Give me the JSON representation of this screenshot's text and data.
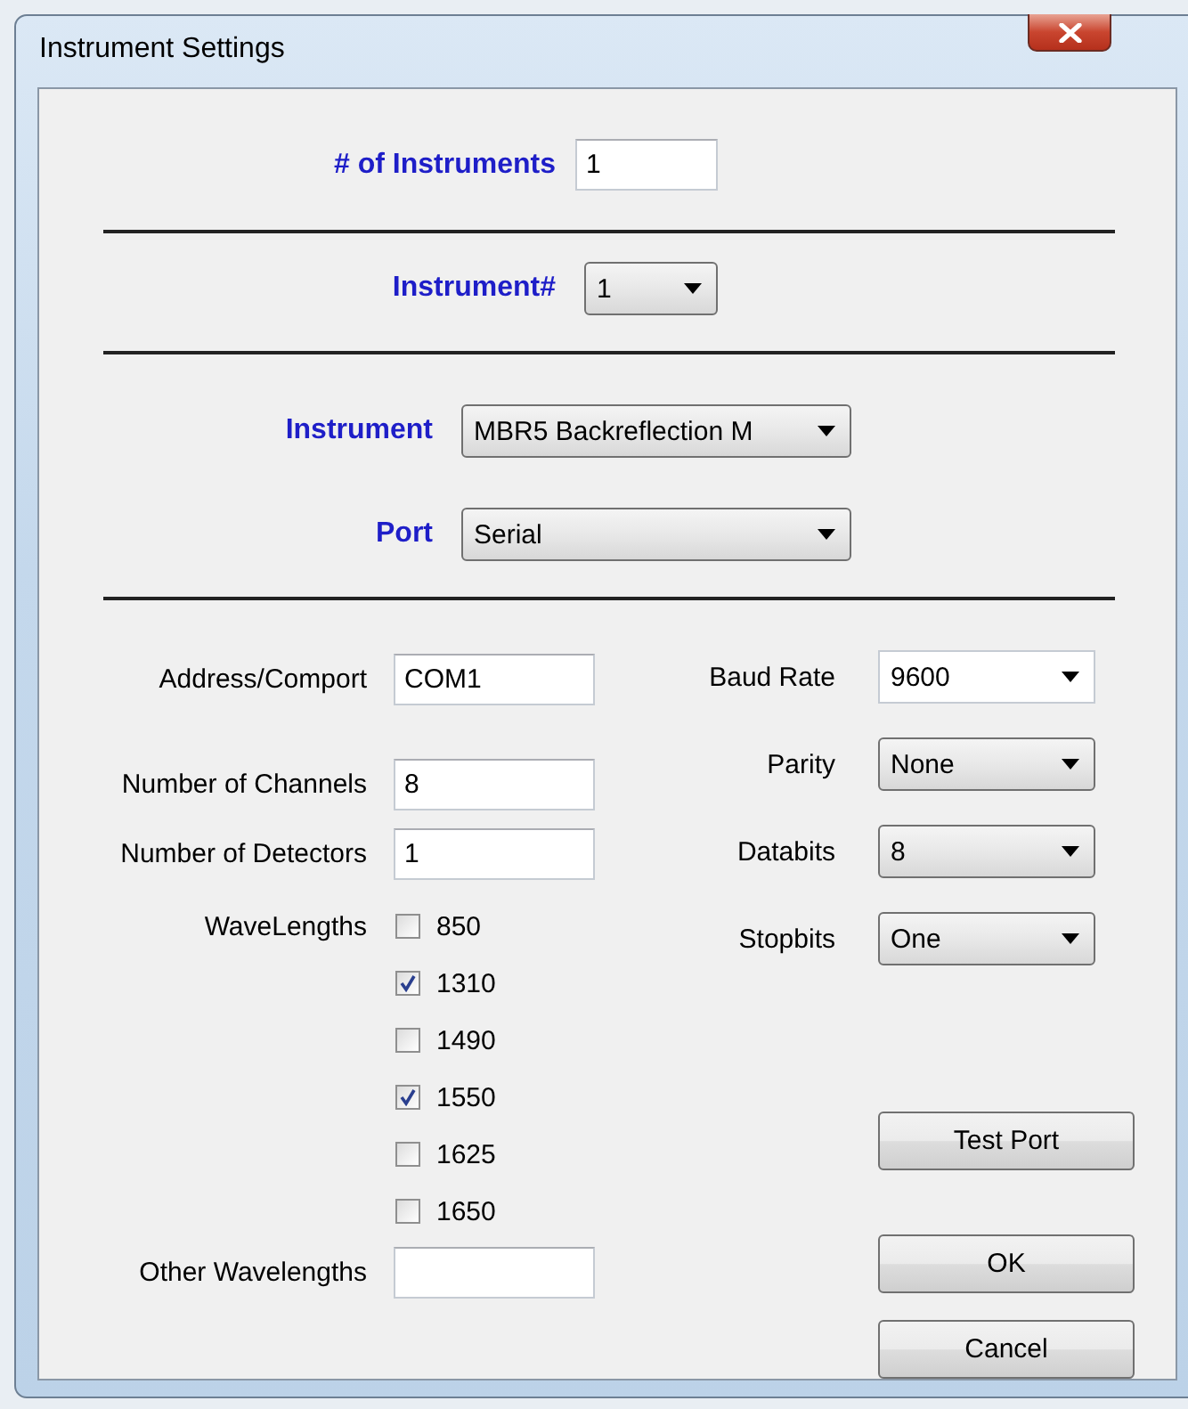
{
  "window": {
    "title": "Instrument Settings"
  },
  "instrument_count": {
    "label": "# of Instruments",
    "value": "1"
  },
  "instrument_number": {
    "label": "Instrument#",
    "value": "1"
  },
  "instrument": {
    "label": "Instrument",
    "value": "MBR5 Backreflection M"
  },
  "port": {
    "label": "Port",
    "value": "Serial"
  },
  "fields": [
    {
      "label": "Address/Comport",
      "value": "COM1"
    },
    {
      "label": "Number of Channels",
      "value": "8"
    },
    {
      "label": "Number of Detectors",
      "value": "1"
    }
  ],
  "wavelengths": {
    "label": "WaveLengths",
    "options": [
      {
        "label": "850",
        "checked": false
      },
      {
        "label": "1310",
        "checked": true
      },
      {
        "label": "1490",
        "checked": false
      },
      {
        "label": "1550",
        "checked": true
      },
      {
        "label": "1625",
        "checked": false
      },
      {
        "label": "1650",
        "checked": false
      }
    ]
  },
  "other_wavelengths": {
    "label": "Other Wavelengths"
  },
  "serial_settings": [
    {
      "label": "Baud Rate",
      "value": "9600",
      "kind": "editable"
    },
    {
      "label": "Parity",
      "value": "None",
      "kind": "list"
    },
    {
      "label": "Databits",
      "value": "8",
      "kind": "list"
    },
    {
      "label": "Stopbits",
      "value": "One",
      "kind": "list"
    }
  ],
  "buttons": [
    "Test Port",
    "OK",
    "Cancel"
  ]
}
